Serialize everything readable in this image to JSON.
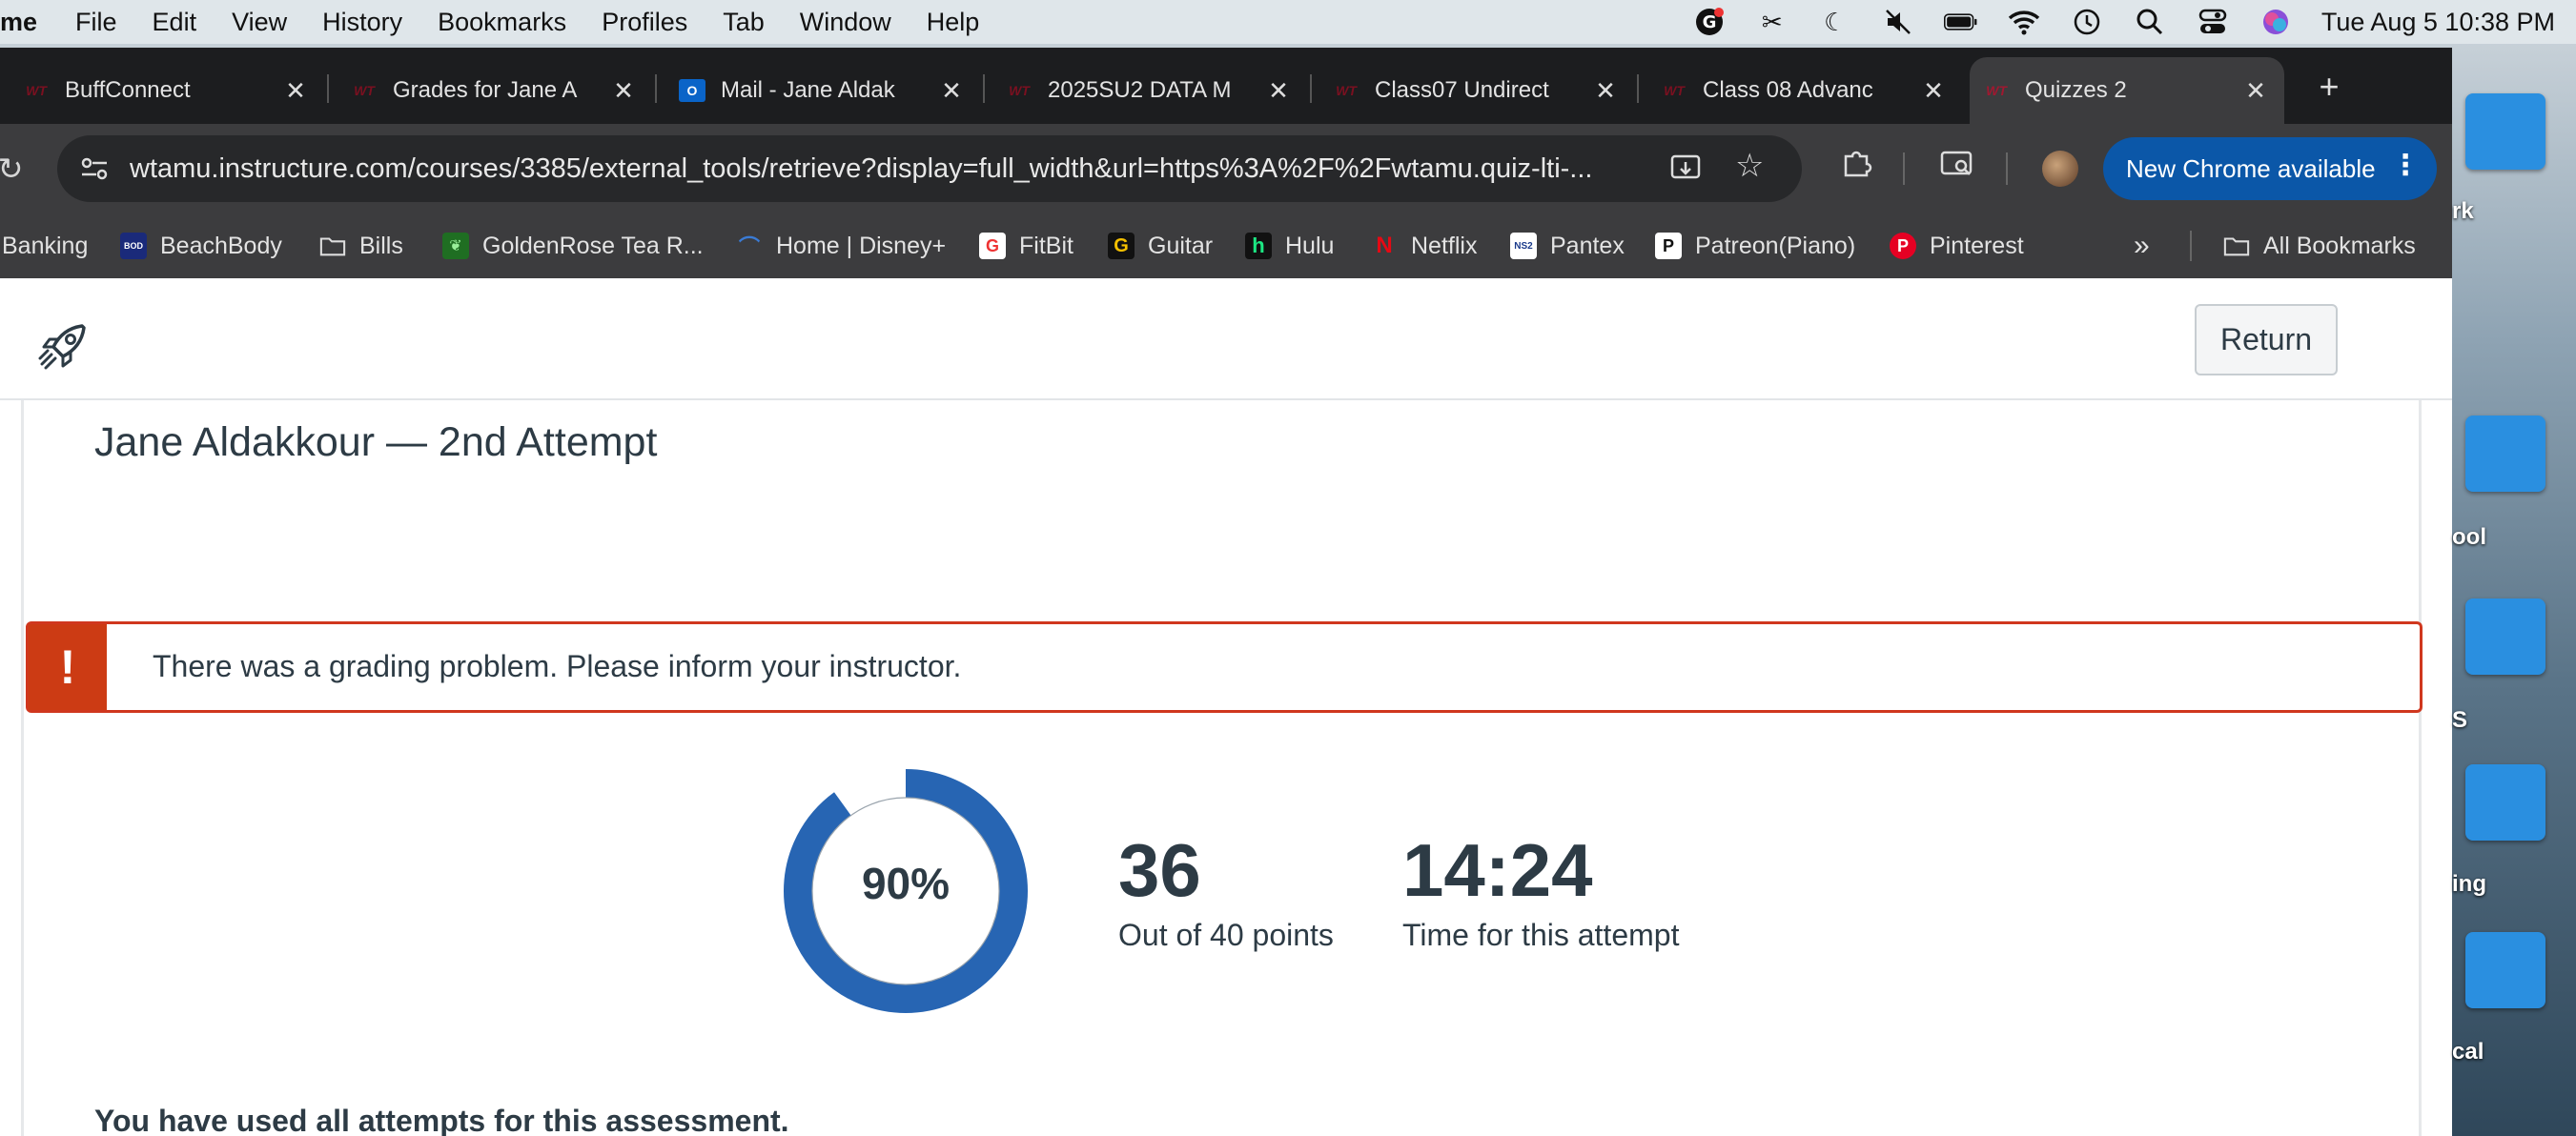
{
  "menubar": {
    "app_name": "me",
    "items": [
      "File",
      "Edit",
      "View",
      "History",
      "Bookmarks",
      "Profiles",
      "Tab",
      "Window",
      "Help"
    ],
    "clock": "Tue Aug 5  10:38 PM"
  },
  "tabs": [
    {
      "title": "BuffConnect",
      "favicon": "WT",
      "active": false
    },
    {
      "title": "Grades for Jane A",
      "favicon": "WT",
      "active": false
    },
    {
      "title": "Mail - Jane Aldak",
      "favicon": "O",
      "active": false
    },
    {
      "title": "2025SU2 DATA M",
      "favicon": "WT",
      "active": false
    },
    {
      "title": "Class07 Undirect",
      "favicon": "WT",
      "active": false
    },
    {
      "title": "Class 08 Advanc",
      "favicon": "WT",
      "active": false
    },
    {
      "title": "Quizzes 2",
      "favicon": "WT",
      "active": true
    }
  ],
  "toolbar": {
    "url": "wtamu.instructure.com/courses/3385/external_tools/retrieve?display=full_width&url=https%3A%2F%2Fwtamu.quiz-lti-...",
    "update_label": "New Chrome available"
  },
  "bookmarks": [
    {
      "label": "Banking",
      "icon": ""
    },
    {
      "label": "BeachBody",
      "icon": "BOD"
    },
    {
      "label": "Bills",
      "icon": "folder"
    },
    {
      "label": "GoldenRose Tea R...",
      "icon": "leaf"
    },
    {
      "label": "Home | Disney+",
      "icon": "disney"
    },
    {
      "label": "FitBit",
      "icon": "G"
    },
    {
      "label": "Guitar",
      "icon": "G"
    },
    {
      "label": "Hulu",
      "icon": "h"
    },
    {
      "label": "Netflix",
      "icon": "N"
    },
    {
      "label": "Pantex",
      "icon": "P"
    },
    {
      "label": "Patreon(Piano)",
      "icon": "P"
    },
    {
      "label": "Pinterest",
      "icon": "P"
    }
  ],
  "all_bookmarks_label": "All Bookmarks",
  "page": {
    "return_label": "Return",
    "attempt_title": "Jane Aldakkour — 2nd Attempt",
    "alert_icon": "!",
    "alert_text": "There was a grading problem. Please inform your instructor.",
    "score_percent": "90%",
    "score_fraction": 0.9,
    "points": "36",
    "points_label": "Out of 40 points",
    "time": "14:24",
    "time_label": "Time for this attempt",
    "attempts_message": "You have used all attempts for this assessment.",
    "ring_color": "#2765b3"
  },
  "desktop_labels": [
    "rk",
    "ool",
    "S",
    "ing",
    "cal"
  ]
}
